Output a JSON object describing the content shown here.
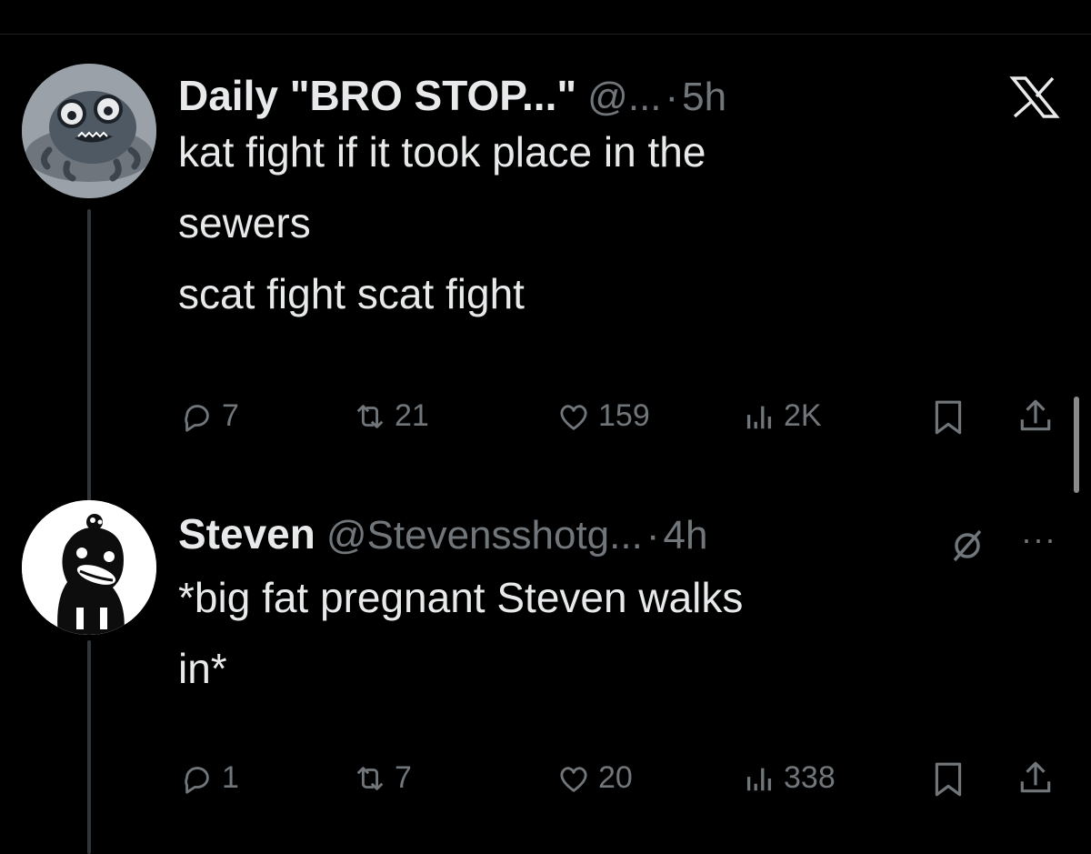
{
  "tweet1": {
    "display_name": "Daily \"BRO STOP...\"",
    "handle": "@...",
    "separator": "·",
    "time": "5h",
    "lines": [
      "kat fight if it took place in the",
      "sewers",
      "scat fight scat fight"
    ],
    "replies": "7",
    "reposts": "21",
    "likes": "159",
    "views": "2K"
  },
  "tweet2": {
    "display_name": "Steven",
    "handle": "@Stevensshotg...",
    "separator": "·",
    "time": "4h",
    "lines": [
      "*big fat pregnant Steven walks",
      "in*"
    ],
    "replies": "1",
    "reposts": "7",
    "likes": "20",
    "views": "338"
  },
  "more_label": "···",
  "icons": [
    "x-logo-icon",
    "reply-icon",
    "repost-icon",
    "like-icon",
    "views-icon",
    "bookmark-icon",
    "share-icon",
    "grok-icon",
    "more-icon"
  ],
  "colors": {
    "background": "#000000",
    "text": "#e7e9ea",
    "secondary": "#71767b",
    "thread_line": "#333639"
  }
}
